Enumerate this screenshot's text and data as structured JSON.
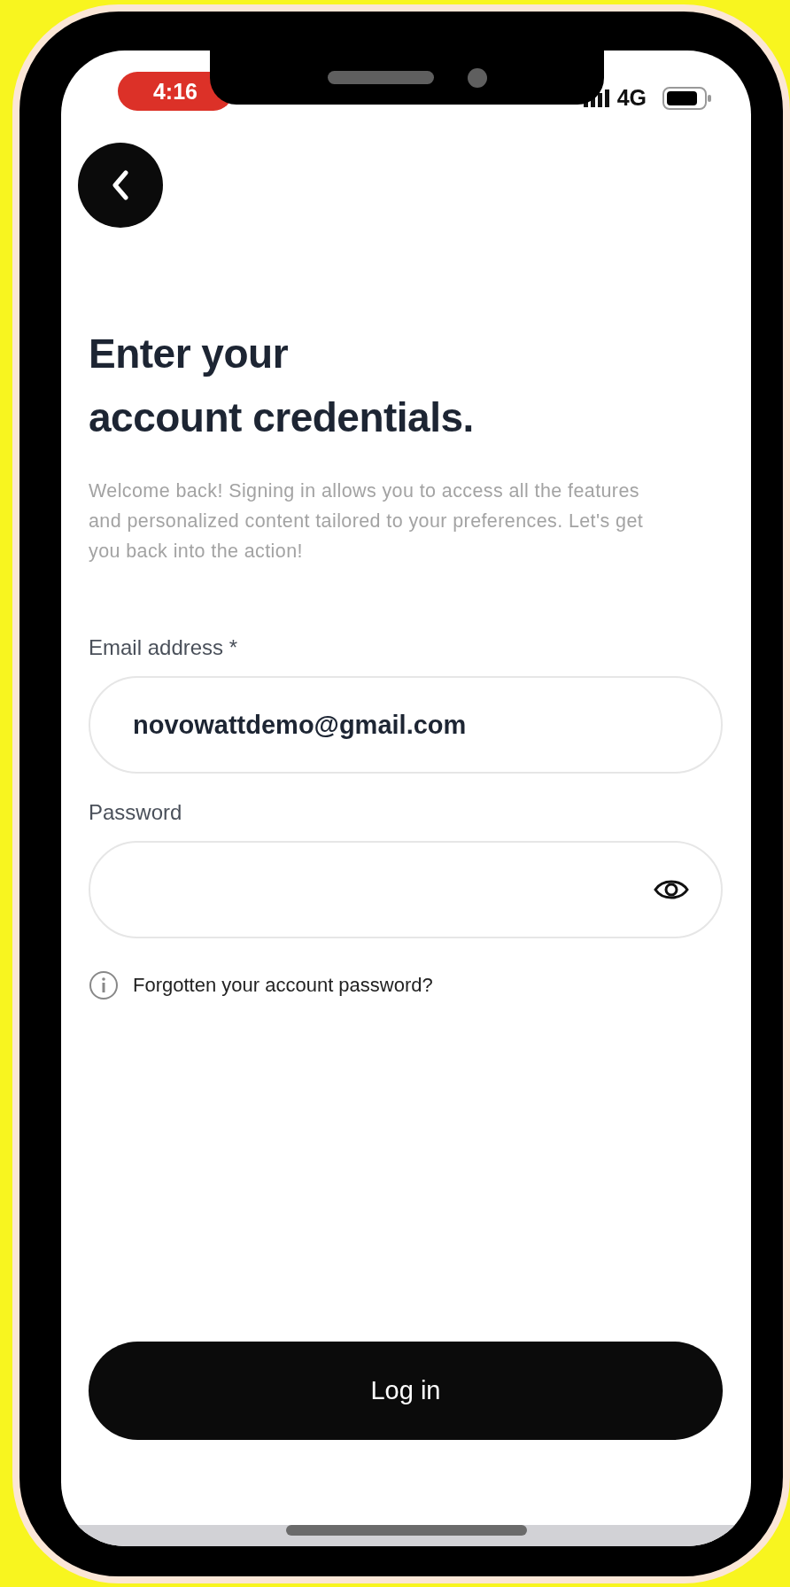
{
  "status_bar": {
    "time": "4:16",
    "network": "4G"
  },
  "heading": {
    "lines": [
      "Enter your",
      "account credentials."
    ]
  },
  "description": "Welcome back! Signing in allows you to access all the features and personalized content tailored to your preferences. Let's get you back into the action!",
  "email": {
    "label": "Email address *",
    "value": "novowattdemo@gmail.com"
  },
  "password": {
    "label": "Password"
  },
  "forgot_link": "Forgotten your account password?",
  "login_button": "Log in"
}
